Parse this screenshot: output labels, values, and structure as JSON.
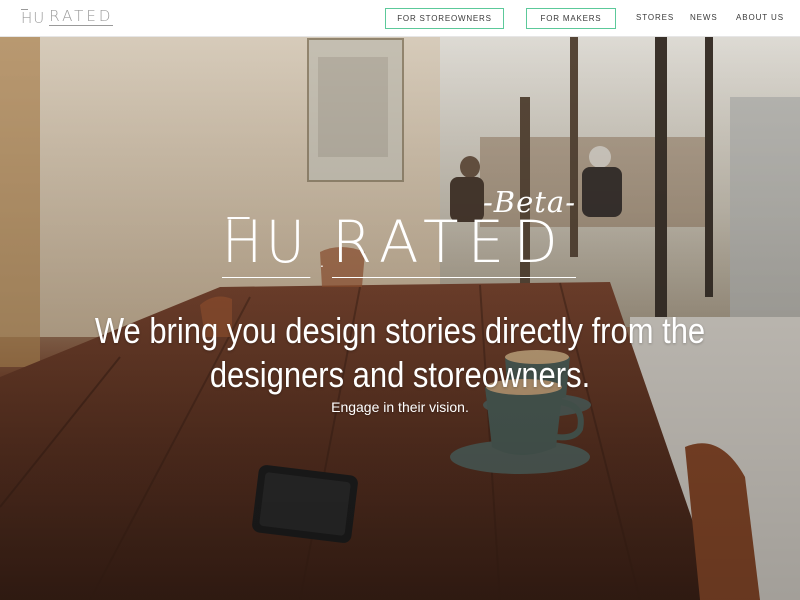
{
  "nav": {
    "logo_hu": "HU",
    "logo_rated": "RATED",
    "btn_storeowners": "FOR STOREOWNERS",
    "btn_makers": "FOR MAKERS",
    "link_stores": "STORES",
    "link_news": "NEWS",
    "link_about": "ABOUT US"
  },
  "hero": {
    "beta_label": "-Beta-",
    "logo_hu": "HU",
    "logo_dot": ".",
    "logo_rated": "RATED",
    "headline": "We bring you design stories directly from the designers and storeowners.",
    "subline": "Engage in their vision."
  },
  "colors": {
    "button_border": "#5cc99a",
    "nav_text": "#3a3a3a",
    "logo_grey": "#9a9a9a"
  }
}
